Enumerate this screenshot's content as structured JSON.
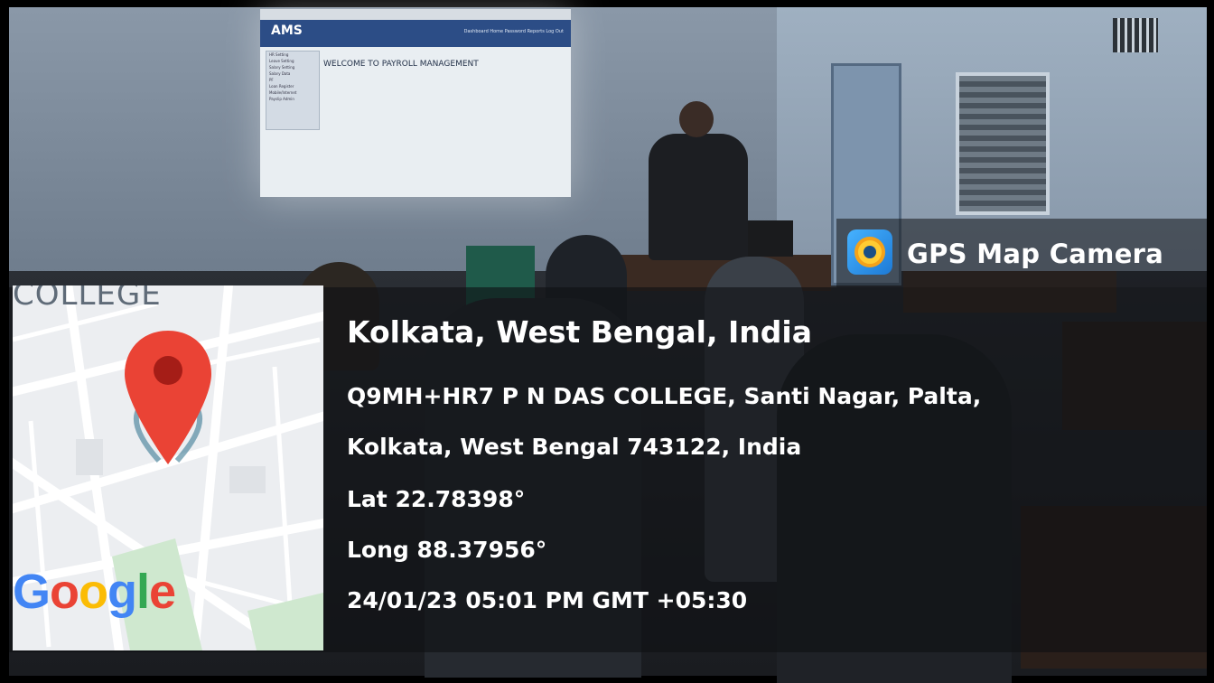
{
  "badge": {
    "icon": "gps-map-camera-app-icon",
    "label": "GPS Map Camera"
  },
  "projection": {
    "logo": "AMS",
    "nav": "Dashboard  Home  Password  Reports  Log Out",
    "welcome": "WELCOME TO PAYROLL MANAGEMENT",
    "sidebar": [
      "HR Setting",
      "Leave Setting",
      "Salary Setting",
      "Salary Data",
      "PF",
      "Loan Register",
      "Mobile/Internet",
      "Payslip Admin"
    ]
  },
  "map": {
    "label": "COLLEGE",
    "provider_parts": [
      "G",
      "o",
      "o",
      "g",
      "l",
      "e"
    ],
    "pin_icon": "map-pin-icon",
    "pin_color": "#ea4335"
  },
  "location": {
    "title": "Kolkata, West Bengal, India",
    "address_line1": "Q9MH+HR7 P N DAS COLLEGE, Santi Nagar, Palta,",
    "address_line2": "Kolkata, West Bengal 743122, India",
    "lat": "Lat 22.78398°",
    "long": "Long 88.37956°",
    "datetime": "24/01/23 05:01 PM GMT +05:30"
  }
}
